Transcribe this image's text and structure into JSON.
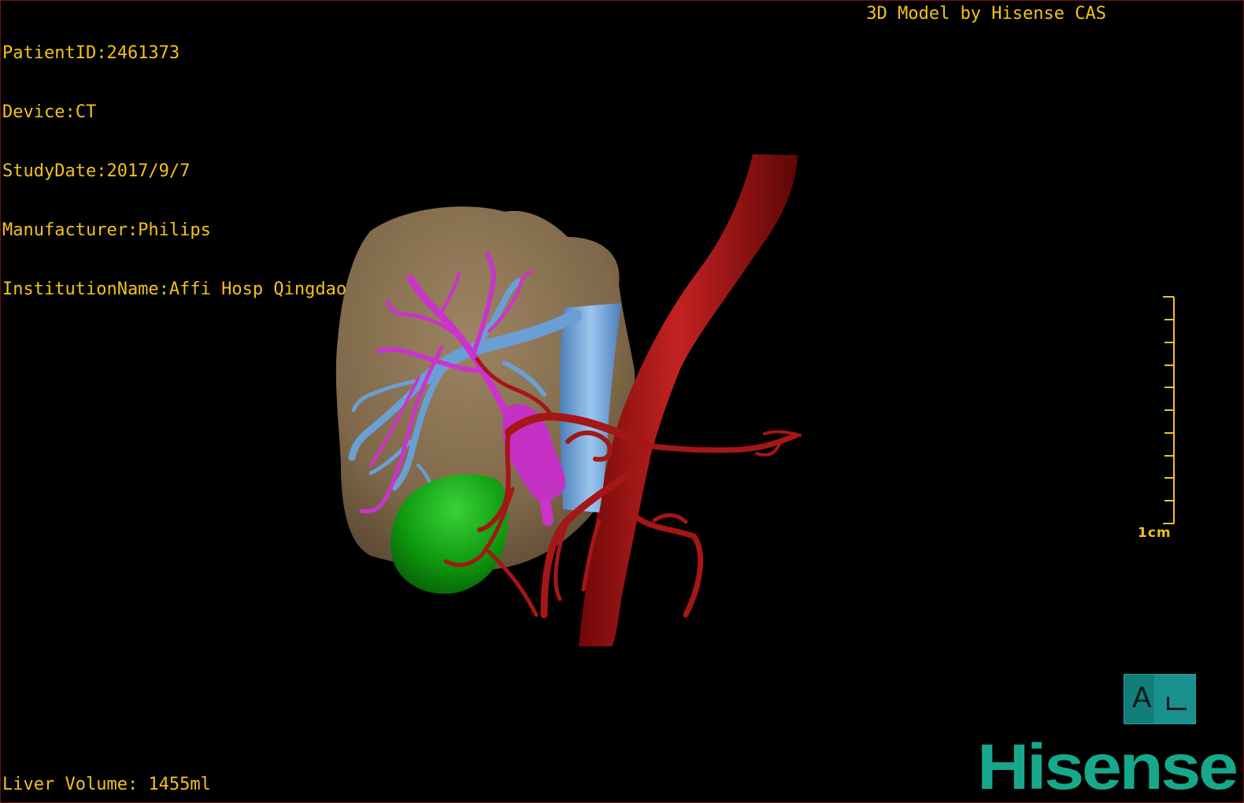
{
  "header": {
    "patient_id": "PatientID:2461373",
    "device": "Device:CT",
    "study_date": "StudyDate:2017/9/7",
    "manufacturer": "Manufacturer:Philips",
    "institution": "InstitutionName:Affi Hosp QingdaoUnW"
  },
  "credit": "3D Model by Hisense CAS",
  "footer": {
    "liver_volume": "Liver Volume: 1455ml"
  },
  "scale_bar": {
    "label": "1cm",
    "ticks": 11
  },
  "orientation_cube": {
    "face_label": "A"
  },
  "brand": {
    "logo_text": "Hisense"
  },
  "colors": {
    "overlay_text": "#f2c21a",
    "liver": "#8c7556",
    "portal_vein": "#6a9fd6",
    "hepatic_vein": "#cc33cc",
    "artery": "#a51616",
    "gallbladder": "#11a511",
    "brand": "#17a88c"
  }
}
